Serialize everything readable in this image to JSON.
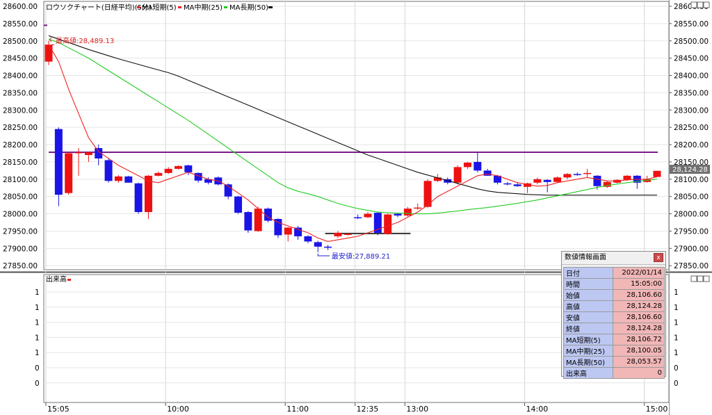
{
  "main_legend": {
    "chart_title": "ロウソクチャート(日経平均)(5分)",
    "ma_short": "MA短期(5)",
    "ma_mid": "MA中期(25)",
    "ma_long": "MA長期(50)"
  },
  "volume_legend": {
    "title": "出来高"
  },
  "annotations": {
    "high": "最高値:28,489.13",
    "low": "最安値:27,889.21"
  },
  "current_price_label": "28,124.28",
  "info_panel": {
    "title": "数値情報画面",
    "close_label": "x",
    "rows": [
      {
        "k": "日付",
        "v": "2022/01/14"
      },
      {
        "k": "時間",
        "v": "15:05:00"
      },
      {
        "k": "始値",
        "v": "28,106.60"
      },
      {
        "k": "高値",
        "v": "28,124.28"
      },
      {
        "k": "安値",
        "v": "28,106.60"
      },
      {
        "k": "終値",
        "v": "28,124.28"
      },
      {
        "k": "MA短期(5)",
        "v": "28,106.72"
      },
      {
        "k": "MA中期(25)",
        "v": "28,100.05"
      },
      {
        "k": "MA長期(50)",
        "v": "28,053.57"
      },
      {
        "k": "出来高",
        "v": "0"
      }
    ]
  },
  "colors": {
    "up": "#ee1111",
    "down": "#1a14e6",
    "ma_short": "#ee2222",
    "ma_mid": "#22cc22",
    "ma_long": "#111111",
    "hline": "#7a1a8a"
  },
  "chart_data": {
    "type": "candlestick",
    "ylim": [
      27850,
      28600
    ],
    "yticks": [
      "28600.00",
      "28550.00",
      "28500.00",
      "28450.00",
      "28400.00",
      "28350.00",
      "28300.00",
      "28250.00",
      "28200.00",
      "28150.00",
      "28100.00",
      "28050.00",
      "28000.00",
      "27950.00",
      "27900.00",
      "27850.00"
    ],
    "right_yticks": [
      "28600.00",
      "28550.00",
      "28500.00",
      "28450.00",
      "28400.00",
      "28350.00",
      "28300.00",
      "28250.00",
      "28200.00",
      "28150.00",
      "28100.00",
      "28050.00",
      "28000.00",
      "27950.00",
      "27900.00",
      "27850.00"
    ],
    "xticks": [
      "15:05",
      "10:00",
      "11:00",
      "12:35",
      "13:00",
      "14:00",
      "15:00"
    ],
    "horizontal_line": 28178,
    "short_bar_level": 27943,
    "candles": [
      {
        "o": 28440,
        "h": 28500,
        "l": 28430,
        "c": 28489
      },
      {
        "o": 28245,
        "h": 28250,
        "l": 28022,
        "c": 28055
      },
      {
        "o": 28060,
        "h": 28178,
        "l": 28055,
        "c": 28175
      },
      {
        "o": 28175,
        "h": 28190,
        "l": 28110,
        "c": 28178
      },
      {
        "o": 28170,
        "h": 28178,
        "l": 28150,
        "c": 28178
      },
      {
        "o": 28190,
        "h": 28200,
        "l": 28140,
        "c": 28160
      },
      {
        "o": 28155,
        "h": 28160,
        "l": 28090,
        "c": 28095
      },
      {
        "o": 28095,
        "h": 28112,
        "l": 28090,
        "c": 28108
      },
      {
        "o": 28108,
        "h": 28110,
        "l": 28090,
        "c": 28090
      },
      {
        "o": 28088,
        "h": 28090,
        "l": 28000,
        "c": 28005
      },
      {
        "o": 28005,
        "h": 28112,
        "l": 27985,
        "c": 28110
      },
      {
        "o": 28110,
        "h": 28122,
        "l": 28108,
        "c": 28118
      },
      {
        "o": 28118,
        "h": 28135,
        "l": 28115,
        "c": 28130
      },
      {
        "o": 28130,
        "h": 28140,
        "l": 28128,
        "c": 28138
      },
      {
        "o": 28140,
        "h": 28142,
        "l": 28112,
        "c": 28120
      },
      {
        "o": 28118,
        "h": 28120,
        "l": 28090,
        "c": 28096
      },
      {
        "o": 28100,
        "h": 28105,
        "l": 28085,
        "c": 28090
      },
      {
        "o": 28105,
        "h": 28108,
        "l": 28082,
        "c": 28085
      },
      {
        "o": 28085,
        "h": 28088,
        "l": 28042,
        "c": 28050
      },
      {
        "o": 28050,
        "h": 28052,
        "l": 28000,
        "c": 28003
      },
      {
        "o": 28005,
        "h": 28008,
        "l": 27945,
        "c": 27952
      },
      {
        "o": 27950,
        "h": 28020,
        "l": 27948,
        "c": 28015
      },
      {
        "o": 28015,
        "h": 28018,
        "l": 27975,
        "c": 27980
      },
      {
        "o": 27985,
        "h": 27987,
        "l": 27930,
        "c": 27938
      },
      {
        "o": 27940,
        "h": 27962,
        "l": 27920,
        "c": 27960
      },
      {
        "o": 27960,
        "h": 27965,
        "l": 27925,
        "c": 27935
      },
      {
        "o": 27935,
        "h": 27938,
        "l": 27915,
        "c": 27920
      },
      {
        "o": 27918,
        "h": 27922,
        "l": 27889,
        "c": 27905
      },
      {
        "o": 27905,
        "h": 27910,
        "l": 27895,
        "c": 27902
      },
      {
        "o": 27935,
        "h": 27950,
        "l": 27930,
        "c": 27945
      },
      {
        "o": 27940,
        "h": 27945,
        "l": 27937,
        "c": 27942
      },
      {
        "o": 27990,
        "h": 27998,
        "l": 27985,
        "c": 27988
      },
      {
        "o": 27990,
        "h": 28005,
        "l": 27988,
        "c": 28000
      },
      {
        "o": 28003,
        "h": 28005,
        "l": 27938,
        "c": 27945
      },
      {
        "o": 27942,
        "h": 28000,
        "l": 27940,
        "c": 27998
      },
      {
        "o": 28000,
        "h": 28002,
        "l": 27990,
        "c": 27995
      },
      {
        "o": 27995,
        "h": 28020,
        "l": 27992,
        "c": 28015
      },
      {
        "o": 28015,
        "h": 28030,
        "l": 28012,
        "c": 28018
      },
      {
        "o": 28020,
        "h": 28100,
        "l": 28018,
        "c": 28095
      },
      {
        "o": 28095,
        "h": 28115,
        "l": 28092,
        "c": 28105
      },
      {
        "o": 28100,
        "h": 28105,
        "l": 28085,
        "c": 28090
      },
      {
        "o": 28090,
        "h": 28140,
        "l": 28085,
        "c": 28135
      },
      {
        "o": 28135,
        "h": 28150,
        "l": 28130,
        "c": 28148
      },
      {
        "o": 28150,
        "h": 28180,
        "l": 28120,
        "c": 28125
      },
      {
        "o": 28125,
        "h": 28130,
        "l": 28110,
        "c": 28110
      },
      {
        "o": 28110,
        "h": 28112,
        "l": 28085,
        "c": 28090
      },
      {
        "o": 28088,
        "h": 28092,
        "l": 28082,
        "c": 28085
      },
      {
        "o": 28085,
        "h": 28090,
        "l": 28078,
        "c": 28080
      },
      {
        "o": 28078,
        "h": 28090,
        "l": 28060,
        "c": 28088
      },
      {
        "o": 28090,
        "h": 28105,
        "l": 28085,
        "c": 28100
      },
      {
        "o": 28098,
        "h": 28100,
        "l": 28062,
        "c": 28092
      },
      {
        "o": 28092,
        "h": 28108,
        "l": 28090,
        "c": 28105
      },
      {
        "o": 28105,
        "h": 28118,
        "l": 28100,
        "c": 28115
      },
      {
        "o": 28115,
        "h": 28120,
        "l": 28110,
        "c": 28112
      },
      {
        "o": 28115,
        "h": 28130,
        "l": 28105,
        "c": 28118
      },
      {
        "o": 28110,
        "h": 28112,
        "l": 28070,
        "c": 28080
      },
      {
        "o": 28078,
        "h": 28095,
        "l": 28075,
        "c": 28092
      },
      {
        "o": 28090,
        "h": 28100,
        "l": 28088,
        "c": 28098
      },
      {
        "o": 28098,
        "h": 28112,
        "l": 28095,
        "c": 28110
      },
      {
        "o": 28110,
        "h": 28112,
        "l": 28072,
        "c": 28090
      },
      {
        "o": 28092,
        "h": 28110,
        "l": 28090,
        "c": 28100
      },
      {
        "o": 28106.6,
        "h": 28124.28,
        "l": 28106.6,
        "c": 28124.28
      }
    ],
    "ma_short": [
      28489,
      28440,
      28360,
      28290,
      28220,
      28180,
      28160,
      28140,
      28125,
      28110,
      28095,
      28090,
      28100,
      28110,
      28120,
      28110,
      28100,
      28095,
      28080,
      28060,
      28040,
      28015,
      27990,
      27975,
      27965,
      27955,
      27945,
      27930,
      27920,
      27925,
      27930,
      27935,
      27945,
      27955,
      27965,
      27975,
      27990,
      28005,
      28025,
      28050,
      28065,
      28080,
      28095,
      28110,
      28115,
      28110,
      28100,
      28090,
      28085,
      28080,
      28082,
      28090,
      28095,
      28100,
      28105,
      28100,
      28095,
      28095,
      28098,
      28100,
      28100,
      28107
    ],
    "ma_mid": [
      28505,
      28495,
      28480,
      28465,
      28450,
      28432,
      28414,
      28396,
      28378,
      28360,
      28342,
      28324,
      28306,
      28288,
      28270,
      28250,
      28230,
      28210,
      28190,
      28170,
      28150,
      28130,
      28110,
      28090,
      28075,
      28065,
      28058,
      28050,
      28040,
      28030,
      28022,
      28015,
      28010,
      28005,
      28003,
      28002,
      28001,
      28000,
      28000,
      28002,
      28005,
      28008,
      28012,
      28015,
      28018,
      28022,
      28026,
      28030,
      28035,
      28040,
      28046,
      28052,
      28058,
      28064,
      28070,
      28076,
      28082,
      28086,
      28090,
      28094,
      28097,
      28100
    ],
    "ma_long": [
      28515,
      28505,
      28495,
      28485,
      28475,
      28466,
      28457,
      28448,
      28440,
      28432,
      28424,
      28416,
      28408,
      28398,
      28386,
      28374,
      28362,
      28350,
      28338,
      28326,
      28314,
      28302,
      28290,
      28278,
      28266,
      28254,
      28242,
      28230,
      28218,
      28206,
      28194,
      28182,
      28170,
      28160,
      28150,
      28140,
      28130,
      28120,
      28112,
      28104,
      28096,
      28088,
      28080,
      28072,
      28066,
      28062,
      28060,
      28058,
      28056,
      28055,
      28054,
      28054,
      28054,
      28054,
      28054,
      28054,
      28054,
      28054,
      28054,
      28054,
      28054,
      28054
    ]
  },
  "volume_data": {
    "ylim": [
      0,
      1
    ],
    "yticks": [
      "1",
      "1",
      "1",
      "1",
      "1",
      "0",
      "0"
    ],
    "right_yticks": [
      "1",
      "1",
      "1",
      "1",
      "1",
      "0",
      "0"
    ],
    "values": [
      0,
      0,
      0,
      0,
      0,
      0,
      0,
      0,
      0,
      0,
      0,
      0,
      0,
      0,
      0,
      0,
      0,
      0,
      0,
      0,
      0,
      0,
      0,
      0,
      0,
      0,
      0,
      0,
      0,
      0,
      0,
      0,
      0,
      0,
      0,
      0,
      0,
      0,
      0,
      0,
      0,
      0,
      0,
      0,
      0,
      0,
      0,
      0,
      0,
      0,
      0,
      0,
      0,
      0,
      0,
      0,
      0,
      0,
      0,
      0,
      0,
      0
    ]
  }
}
